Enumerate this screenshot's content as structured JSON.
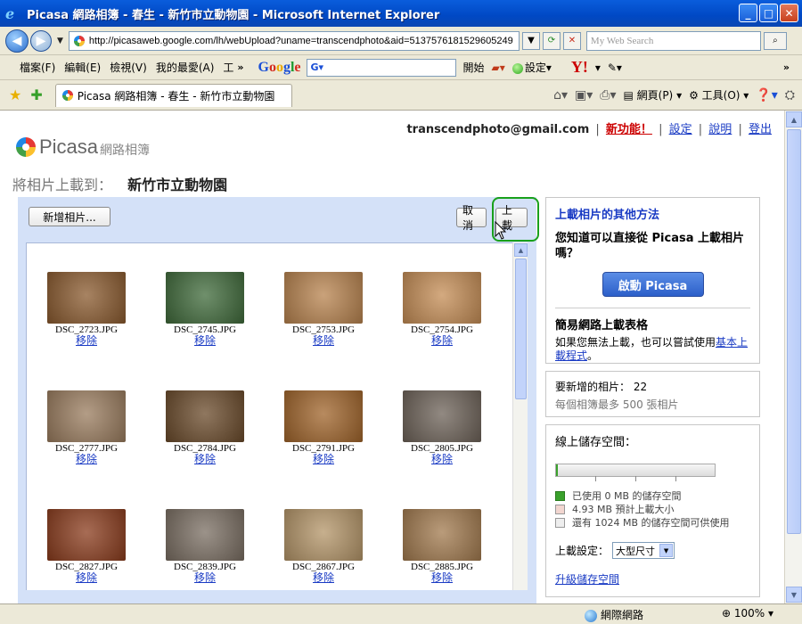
{
  "window": {
    "title": "Picasa 網路相簿 - 春生 - 新竹市立動物園 - Microsoft Internet Explorer"
  },
  "address": {
    "url": "http://picasaweb.google.com/lh/webUpload?uname=transcendphoto&aid=5137576181529605249",
    "search_placeholder": "My Web Search"
  },
  "menu": {
    "items": [
      "檔案(F)",
      "編輯(E)",
      "檢視(V)",
      "我的最愛(A)",
      "工"
    ],
    "google_search_value": "G▾",
    "open_label": "開始",
    "settings_label": "設定▾"
  },
  "tab": {
    "title": "Picasa 網路相簿 - 春生 - 新竹市立動物園"
  },
  "commandbar": {
    "page_label": "網頁(P)",
    "tools_label": "工具(O)"
  },
  "header": {
    "email": "transcendphoto@gmail.com",
    "new_features": "新功能！",
    "settings": "設定",
    "help": "說明",
    "logout": "登出"
  },
  "logo": {
    "name": "Picasa",
    "sub": "網路相簿"
  },
  "upload": {
    "heading_label": "將相片上載到：",
    "album": "新竹市立動物園",
    "add_button": "新增相片...",
    "cancel_button": "取消",
    "upload_button": "上載",
    "remove_label": "移除",
    "photos": [
      {
        "file": "DSC_2723.JPG",
        "color": "#8a5a2e"
      },
      {
        "file": "DSC_2745.JPG",
        "color": "#3f6a3a"
      },
      {
        "file": "DSC_2753.JPG",
        "color": "#b8834e"
      },
      {
        "file": "DSC_2754.JPG",
        "color": "#c58d55"
      },
      {
        "file": "DSC_2777.JPG",
        "color": "#9a7c5e"
      },
      {
        "file": "DSC_2784.JPG",
        "color": "#6a4a2a"
      },
      {
        "file": "DSC_2791.JPG",
        "color": "#a0642a"
      },
      {
        "file": "DSC_2805.JPG",
        "color": "#6d6258"
      },
      {
        "file": "DSC_2827.JPG",
        "color": "#8a3b1c"
      },
      {
        "file": "DSC_2839.JPG",
        "color": "#7a6e62"
      },
      {
        "file": "DSC_2867.JPG",
        "color": "#b49568"
      },
      {
        "file": "DSC_2885.JPG",
        "color": "#a27a4e"
      }
    ]
  },
  "sidebar": {
    "other_methods_title": "上載相片的其他方法",
    "question": "您知道可以直接從 Picasa 上載相片嗎？",
    "start_button": "啟動 Picasa",
    "simple_title": "簡易網路上載表格",
    "simple_text": "如果您無法上載，也可以嘗試使用",
    "simple_link": "基本上載程式",
    "simple_end": "。",
    "new_photos_label": "要新增的相片：",
    "new_photos_count": "22",
    "max_label": "每個相簿最多 500 張相片",
    "storage_title": "線上儲存空間：",
    "storage_used_fraction": 0.001,
    "legend_used": "已使用 0 MB 的儲存空間",
    "legend_estimated": "4.93 MB 預計上載大小",
    "legend_free": "還有 1024 MB 的儲存空間可供使用",
    "upload_settings_label": "上載設定：",
    "upload_size": "大型尺寸",
    "upgrade_link": "升級儲存空間"
  },
  "status": {
    "zone": "網際網路",
    "zoom": "100%"
  },
  "colors": {
    "panel_bg": "#d4e1f8",
    "highlight": "#19a01c",
    "link": "#1a3bc4"
  }
}
